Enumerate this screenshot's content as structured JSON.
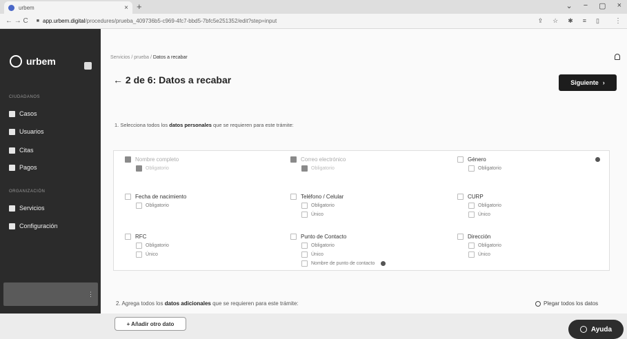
{
  "browser": {
    "tab_title": "urbem",
    "tab_close": "×",
    "new_tab": "+",
    "controls": [
      "⌄",
      "−",
      "▢",
      "×"
    ],
    "nav": "← → C",
    "url_host": "app.urbem.digital",
    "url_path": "/procedures/prueba_409736b5-c969-4fc7-bbd5-7bfc5e251352/edit?step=input"
  },
  "sidebar": {
    "brand": "urbem",
    "section_citizens": "CIUDADANOS",
    "items_citizens": [
      {
        "label": "Casos",
        "icon": "folder-icon"
      },
      {
        "label": "Usuarios",
        "icon": "user-icon"
      },
      {
        "label": "Citas",
        "icon": "calendar-icon"
      },
      {
        "label": "Pagos",
        "icon": "payments-icon"
      }
    ],
    "section_org": "ORGANIZACIÓN",
    "items_org": [
      {
        "label": "Servicios",
        "icon": "services-icon"
      },
      {
        "label": "Configuración",
        "icon": "gear-icon"
      }
    ]
  },
  "main": {
    "breadcrumb": {
      "a": "Servicios",
      "b": "prueba",
      "c": "Datos a recabar",
      "sep": "/"
    },
    "title": "← 2 de 6: Datos a recabar",
    "next_label": "Siguiente",
    "next_arrow": "›",
    "step1_pre": "1. Selecciona todos los",
    "step1_bold": "datos personales",
    "step1_post": "que se requieren para este trámite:",
    "fields": [
      {
        "label": "Nombre completo",
        "checked": true,
        "disabled": true,
        "options": [
          {
            "label": "Obligatorio",
            "checked": true
          }
        ]
      },
      {
        "label": "Correo electrónico",
        "checked": true,
        "disabled": true,
        "options": [
          {
            "label": "Obligatorio",
            "checked": true
          }
        ]
      },
      {
        "label": "Género",
        "checked": false,
        "disabled": false,
        "options": [
          {
            "label": "Obligatorio",
            "checked": false
          }
        ]
      },
      {
        "label": "Fecha de nacimiento",
        "checked": false,
        "disabled": false,
        "options": [
          {
            "label": "Obligatorio",
            "checked": false
          }
        ]
      },
      {
        "label": "Teléfono / Celular",
        "checked": false,
        "disabled": false,
        "options": [
          {
            "label": "Obligatorio",
            "checked": false
          },
          {
            "label": "Único",
            "checked": false
          }
        ]
      },
      {
        "label": "CURP",
        "checked": false,
        "disabled": false,
        "options": [
          {
            "label": "Obligatorio",
            "checked": false
          },
          {
            "label": "Único",
            "checked": false
          }
        ]
      },
      {
        "label": "RFC",
        "checked": false,
        "disabled": false,
        "options": [
          {
            "label": "Obligatorio",
            "checked": false
          },
          {
            "label": "Único",
            "checked": false
          }
        ]
      },
      {
        "label": "Punto de Contacto",
        "checked": false,
        "disabled": false,
        "options": [
          {
            "label": "Obligatorio",
            "checked": false
          },
          {
            "label": "Único",
            "checked": false
          },
          {
            "label": "Nombre de punto de contacto",
            "checked": false
          }
        ]
      },
      {
        "label": "Dirección",
        "checked": false,
        "disabled": false,
        "options": [
          {
            "label": "Obligatorio",
            "checked": false
          },
          {
            "label": "Único",
            "checked": false
          }
        ]
      }
    ],
    "step2_pre": "2. Agrega todos los",
    "step2_bold": "datos adicionales",
    "step2_post": "que se requieren para este trámite:",
    "clear_all": "Plegar todos los datos",
    "add_button": "+ Añadir otro dato",
    "help": "Ayuda"
  }
}
